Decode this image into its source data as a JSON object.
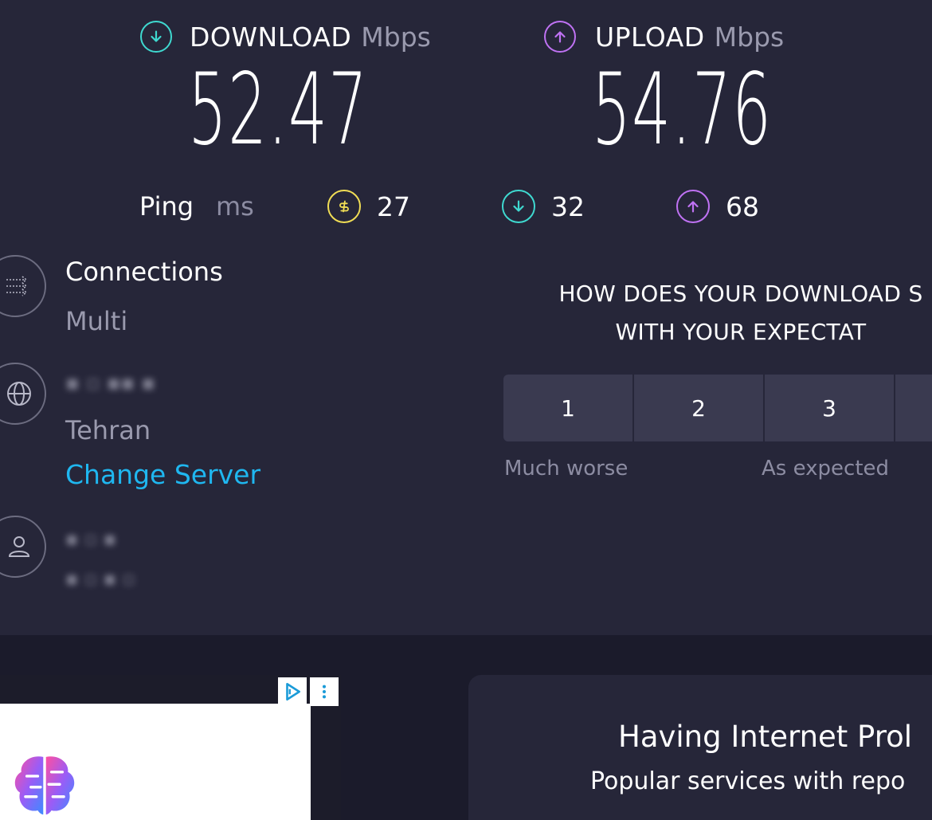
{
  "download": {
    "title": "DOWNLOAD",
    "unit": "Mbps",
    "value": "52.47",
    "icon": "arrow-down-circle-icon",
    "color": "#3fd9d0"
  },
  "upload": {
    "title": "UPLOAD",
    "unit": "Mbps",
    "value": "54.76",
    "icon": "arrow-up-circle-icon",
    "color": "#bf72f3"
  },
  "ping": {
    "label": "Ping",
    "unit": "ms",
    "idle": {
      "value": "27",
      "icon": "ping-idle-icon",
      "color": "#f0dd55"
    },
    "download": {
      "value": "32",
      "icon": "ping-download-icon",
      "color": "#3fd9d0"
    },
    "upload": {
      "value": "68",
      "icon": "ping-upload-icon",
      "color": "#bf72f3"
    }
  },
  "connections": {
    "title": "Connections",
    "value": "Multi",
    "icon": "connections-icon"
  },
  "server": {
    "location": "Tehran",
    "change_label": "Change Server",
    "icon": "globe-icon"
  },
  "provider": {
    "icon": "user-icon"
  },
  "survey": {
    "question_line1": "HOW DOES YOUR DOWNLOAD S",
    "question_line2": "WITH YOUR EXPECTAT",
    "options": [
      "1",
      "2",
      "3"
    ],
    "caption_low": "Much worse",
    "caption_mid": "As expected"
  },
  "help_card": {
    "title": "Having Internet Prol",
    "subtitle": "Popular services with repo"
  },
  "colors": {
    "link": "#1fb7f0",
    "panel": "#262639",
    "background": "#1b1b2b"
  }
}
